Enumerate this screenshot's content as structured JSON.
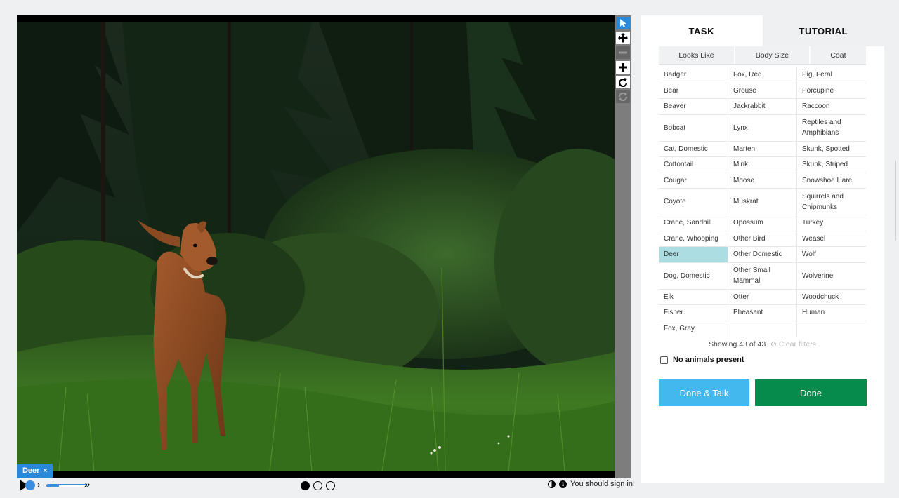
{
  "tabs": {
    "task": "TASK",
    "tutorial": "TUTORIAL"
  },
  "filters": [
    "Looks Like",
    "Body Size",
    "Coat"
  ],
  "choices": {
    "rows": [
      [
        "Badger",
        "Fox, Red",
        "Pig, Feral"
      ],
      [
        "Bear",
        "Grouse",
        "Porcupine"
      ],
      [
        "Beaver",
        "Jackrabbit",
        "Raccoon"
      ],
      [
        "Bobcat",
        "Lynx",
        "Reptiles and Amphibians"
      ],
      [
        "Cat, Domestic",
        "Marten",
        "Skunk, Spotted"
      ],
      [
        "Cottontail",
        "Mink",
        "Skunk, Striped"
      ],
      [
        "Cougar",
        "Moose",
        "Snowshoe Hare"
      ],
      [
        "Coyote",
        "Muskrat",
        "Squirrels and Chipmunks"
      ],
      [
        "Crane, Sandhill",
        "Opossum",
        "Turkey"
      ],
      [
        "Crane, Whooping",
        "Other Bird",
        "Weasel"
      ],
      [
        "Deer",
        "Other Domestic",
        "Wolf"
      ],
      [
        "Dog, Domestic",
        "Other Small Mammal",
        "Wolverine"
      ],
      [
        "Elk",
        "Otter",
        "Woodchuck"
      ],
      [
        "Fisher",
        "Pheasant",
        "Human"
      ],
      [
        "Fox, Gray",
        "",
        ""
      ]
    ],
    "selected": "Deer"
  },
  "status": {
    "showing": "Showing 43 of 43",
    "clear_filters": "Clear filters"
  },
  "no_animals": "No animals present",
  "buttons": {
    "done_talk": "Done & Talk",
    "done": "Done"
  },
  "annotation": {
    "label": "Deer",
    "remove": "×"
  },
  "controls": {
    "step_small": "›",
    "step_fast": "»",
    "frames": 3,
    "current_frame": 1
  },
  "signin": "You should sign in!",
  "icons": {
    "tools": [
      "pointer-icon",
      "move-icon",
      "zoom-out-icon",
      "zoom-in-icon",
      "rotate-icon",
      "reset-icon"
    ],
    "info": "i"
  },
  "colors": {
    "accent": "#2a88d8",
    "done": "#068b4c",
    "talk": "#43b8ee",
    "selected": "#acdde2"
  }
}
